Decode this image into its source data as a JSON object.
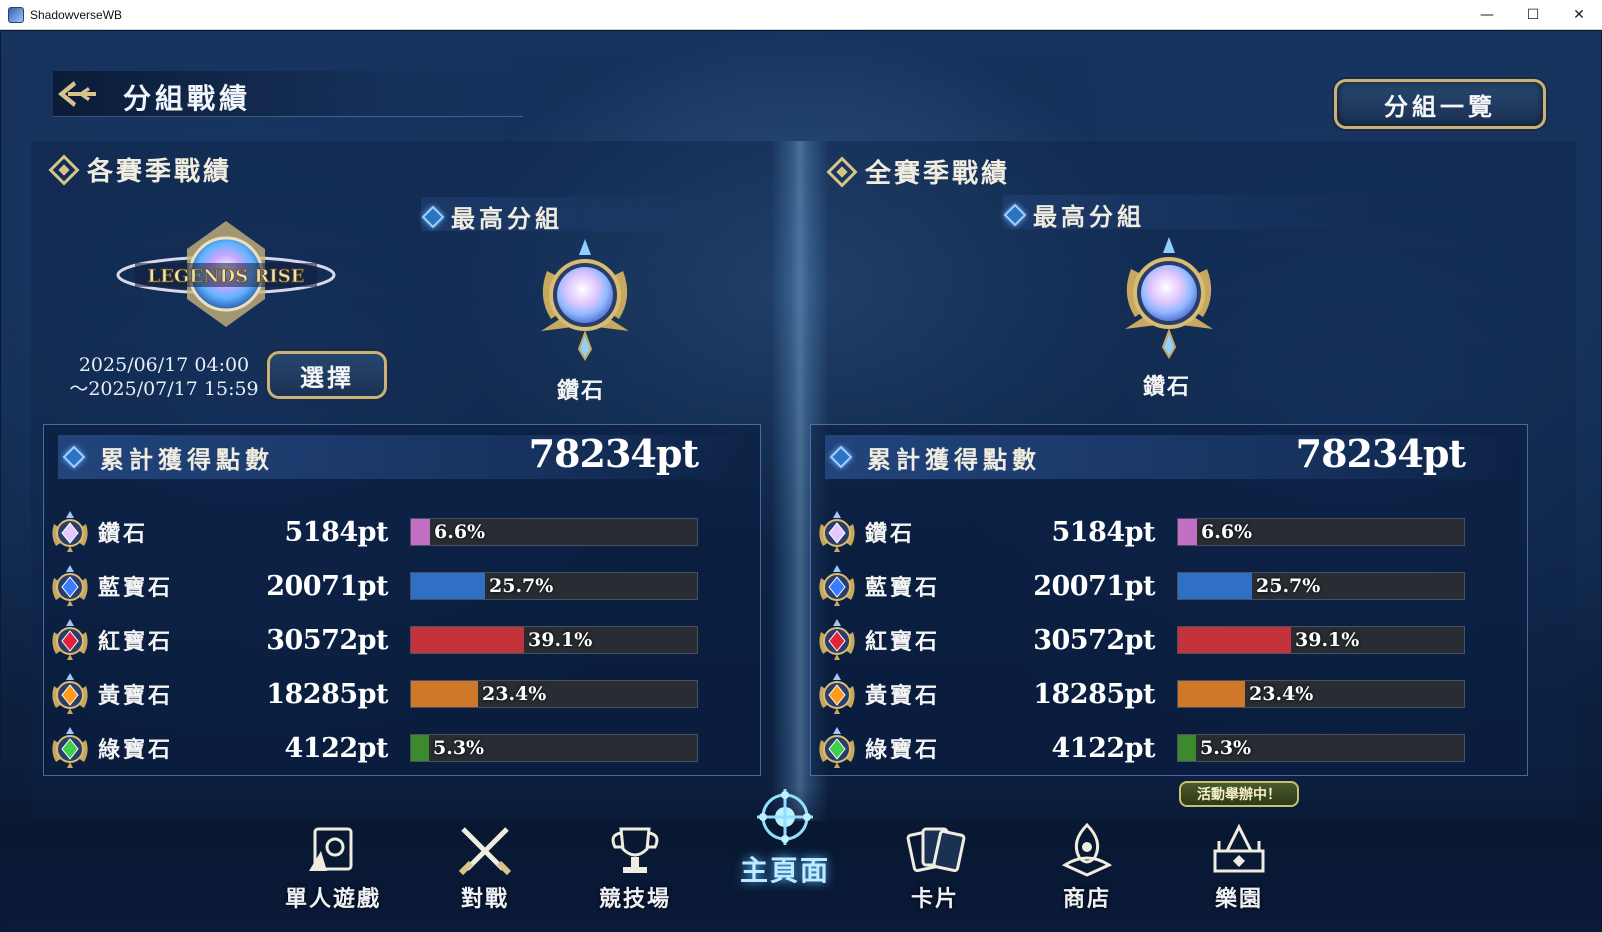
{
  "window": {
    "title": "ShadowverseWB",
    "minimize": "—",
    "maximize": "☐",
    "close": "✕"
  },
  "header": {
    "title": "分組戰績",
    "list_button": "分組一覽"
  },
  "season": {
    "heading": "各賽季戰績",
    "logo_text": "LEGENDS RISE",
    "date_start": "2025/06/17 04:00",
    "date_end": "～2025/07/17 15:59",
    "select_button": "選擇",
    "best_heading": "最高分組",
    "best_rank": "鑽石",
    "total_label": "累計獲得點數",
    "total_value": "78234pt",
    "ranks": [
      {
        "name": "鑽石",
        "points": "5184pt",
        "percent": "6.6%",
        "fraction": 0.066,
        "color": "#c36fc4",
        "gem": "#e6c8ff"
      },
      {
        "name": "藍寶石",
        "points": "20071pt",
        "percent": "25.7%",
        "fraction": 0.257,
        "color": "#2f6fc4",
        "gem": "#3a7cff"
      },
      {
        "name": "紅寶石",
        "points": "30572pt",
        "percent": "39.1%",
        "fraction": 0.391,
        "color": "#c4323c",
        "gem": "#e0243a"
      },
      {
        "name": "黃寶石",
        "points": "18285pt",
        "percent": "23.4%",
        "fraction": 0.234,
        "color": "#d0782a",
        "gem": "#ff9a1a"
      },
      {
        "name": "綠寶石",
        "points": "4122pt",
        "percent": "5.3%",
        "fraction": 0.053,
        "color": "#3d8a2e",
        "gem": "#3fcf4a"
      }
    ]
  },
  "alltime": {
    "heading": "全賽季戰績",
    "best_heading": "最高分組",
    "best_rank": "鑽石",
    "total_label": "累計獲得點數",
    "total_value": "78234pt",
    "ranks": [
      {
        "name": "鑽石",
        "points": "5184pt",
        "percent": "6.6%",
        "fraction": 0.066,
        "color": "#c36fc4",
        "gem": "#e6c8ff"
      },
      {
        "name": "藍寶石",
        "points": "20071pt",
        "percent": "25.7%",
        "fraction": 0.257,
        "color": "#2f6fc4",
        "gem": "#3a7cff"
      },
      {
        "name": "紅寶石",
        "points": "30572pt",
        "percent": "39.1%",
        "fraction": 0.391,
        "color": "#c4323c",
        "gem": "#e0243a"
      },
      {
        "name": "黃寶石",
        "points": "18285pt",
        "percent": "23.4%",
        "fraction": 0.234,
        "color": "#d0782a",
        "gem": "#ff9a1a"
      },
      {
        "name": "綠寶石",
        "points": "4122pt",
        "percent": "5.3%",
        "fraction": 0.053,
        "color": "#3d8a2e",
        "gem": "#3fcf4a"
      }
    ]
  },
  "nav": {
    "items": [
      {
        "label": "單人遊戲",
        "icon": "solo-play-icon"
      },
      {
        "label": "對戰",
        "icon": "crossed-swords-icon"
      },
      {
        "label": "競技場",
        "icon": "trophy-icon"
      },
      {
        "label": "主頁面",
        "icon": "home-emblem-icon"
      },
      {
        "label": "卡片",
        "icon": "cards-icon"
      },
      {
        "label": "商店",
        "icon": "shop-icon"
      },
      {
        "label": "樂園",
        "icon": "park-icon"
      }
    ],
    "event_badge": "活動舉辦中！"
  }
}
